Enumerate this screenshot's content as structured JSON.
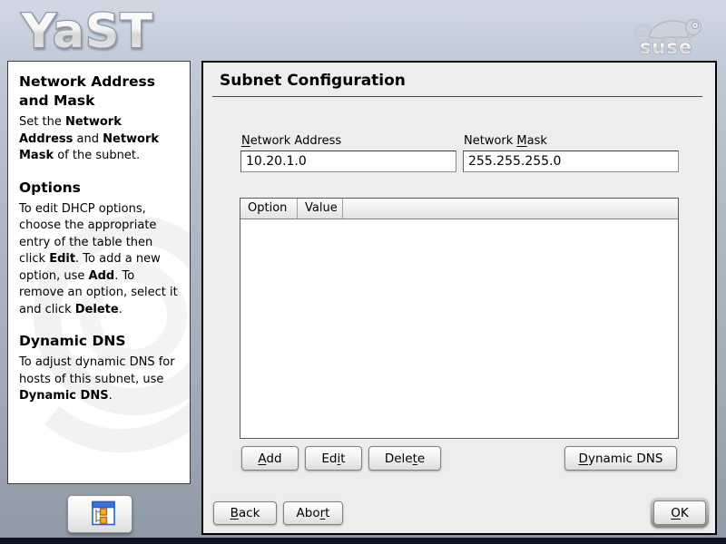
{
  "banner": {
    "yast_logo": "YaST",
    "suse_logo": "suse"
  },
  "sidebar": {
    "sections": [
      {
        "heading": "Network Address and Mask",
        "body": [
          {
            "t": "Set the ",
            "b": false
          },
          {
            "t": "Network Address",
            "b": true
          },
          {
            "t": " and ",
            "b": false
          },
          {
            "t": "Network Mask",
            "b": true
          },
          {
            "t": " of the subnet.",
            "b": false
          }
        ]
      },
      {
        "heading": "Options",
        "body": [
          {
            "t": "To edit DHCP options, choose the appropriate entry of the table then click ",
            "b": false
          },
          {
            "t": "Edit",
            "b": true
          },
          {
            "t": ". To add a new option, use ",
            "b": false
          },
          {
            "t": "Add",
            "b": true
          },
          {
            "t": ". To remove an option, select it and click ",
            "b": false
          },
          {
            "t": "Delete",
            "b": true
          },
          {
            "t": ".",
            "b": false
          }
        ]
      },
      {
        "heading": "Dynamic DNS",
        "body": [
          {
            "t": "To adjust dynamic DNS for hosts of this subnet, use ",
            "b": false
          },
          {
            "t": "Dynamic DNS",
            "b": true
          },
          {
            "t": ".",
            "b": false
          }
        ]
      }
    ]
  },
  "main": {
    "title": "Subnet Configuration",
    "fields": [
      {
        "label": {
          "pre": "",
          "key": "N",
          "post": "etwork Address"
        },
        "value": "10.20.1.0"
      },
      {
        "label": {
          "pre": "Network ",
          "key": "M",
          "post": "ask"
        },
        "value": "255.255.255.0"
      }
    ],
    "table": {
      "columns": [
        "Option",
        "Value"
      ],
      "rows": []
    },
    "action_buttons": {
      "add": {
        "pre": "",
        "key": "A",
        "post": "dd"
      },
      "edit": {
        "pre": "Ed",
        "key": "i",
        "post": "t"
      },
      "delete": {
        "pre": "Dele",
        "key": "t",
        "post": "e"
      },
      "dynamic_dns": {
        "pre": "",
        "key": "D",
        "post": "ynamic DNS"
      }
    },
    "nav_buttons": {
      "back": {
        "pre": "",
        "key": "B",
        "post": "ack"
      },
      "abort": {
        "pre": "Abo",
        "key": "r",
        "post": "t"
      },
      "ok": {
        "pre": "",
        "key": "O",
        "post": "K"
      }
    }
  },
  "colors": {
    "panel_bg": "#ededed",
    "banner_top": "#d0d9e5",
    "banner_bottom": "#909ba7",
    "bottom_strip": "#0d1522",
    "icon_window_blue": "#2c5fc2",
    "icon_square_orange": "#f3ab36"
  }
}
